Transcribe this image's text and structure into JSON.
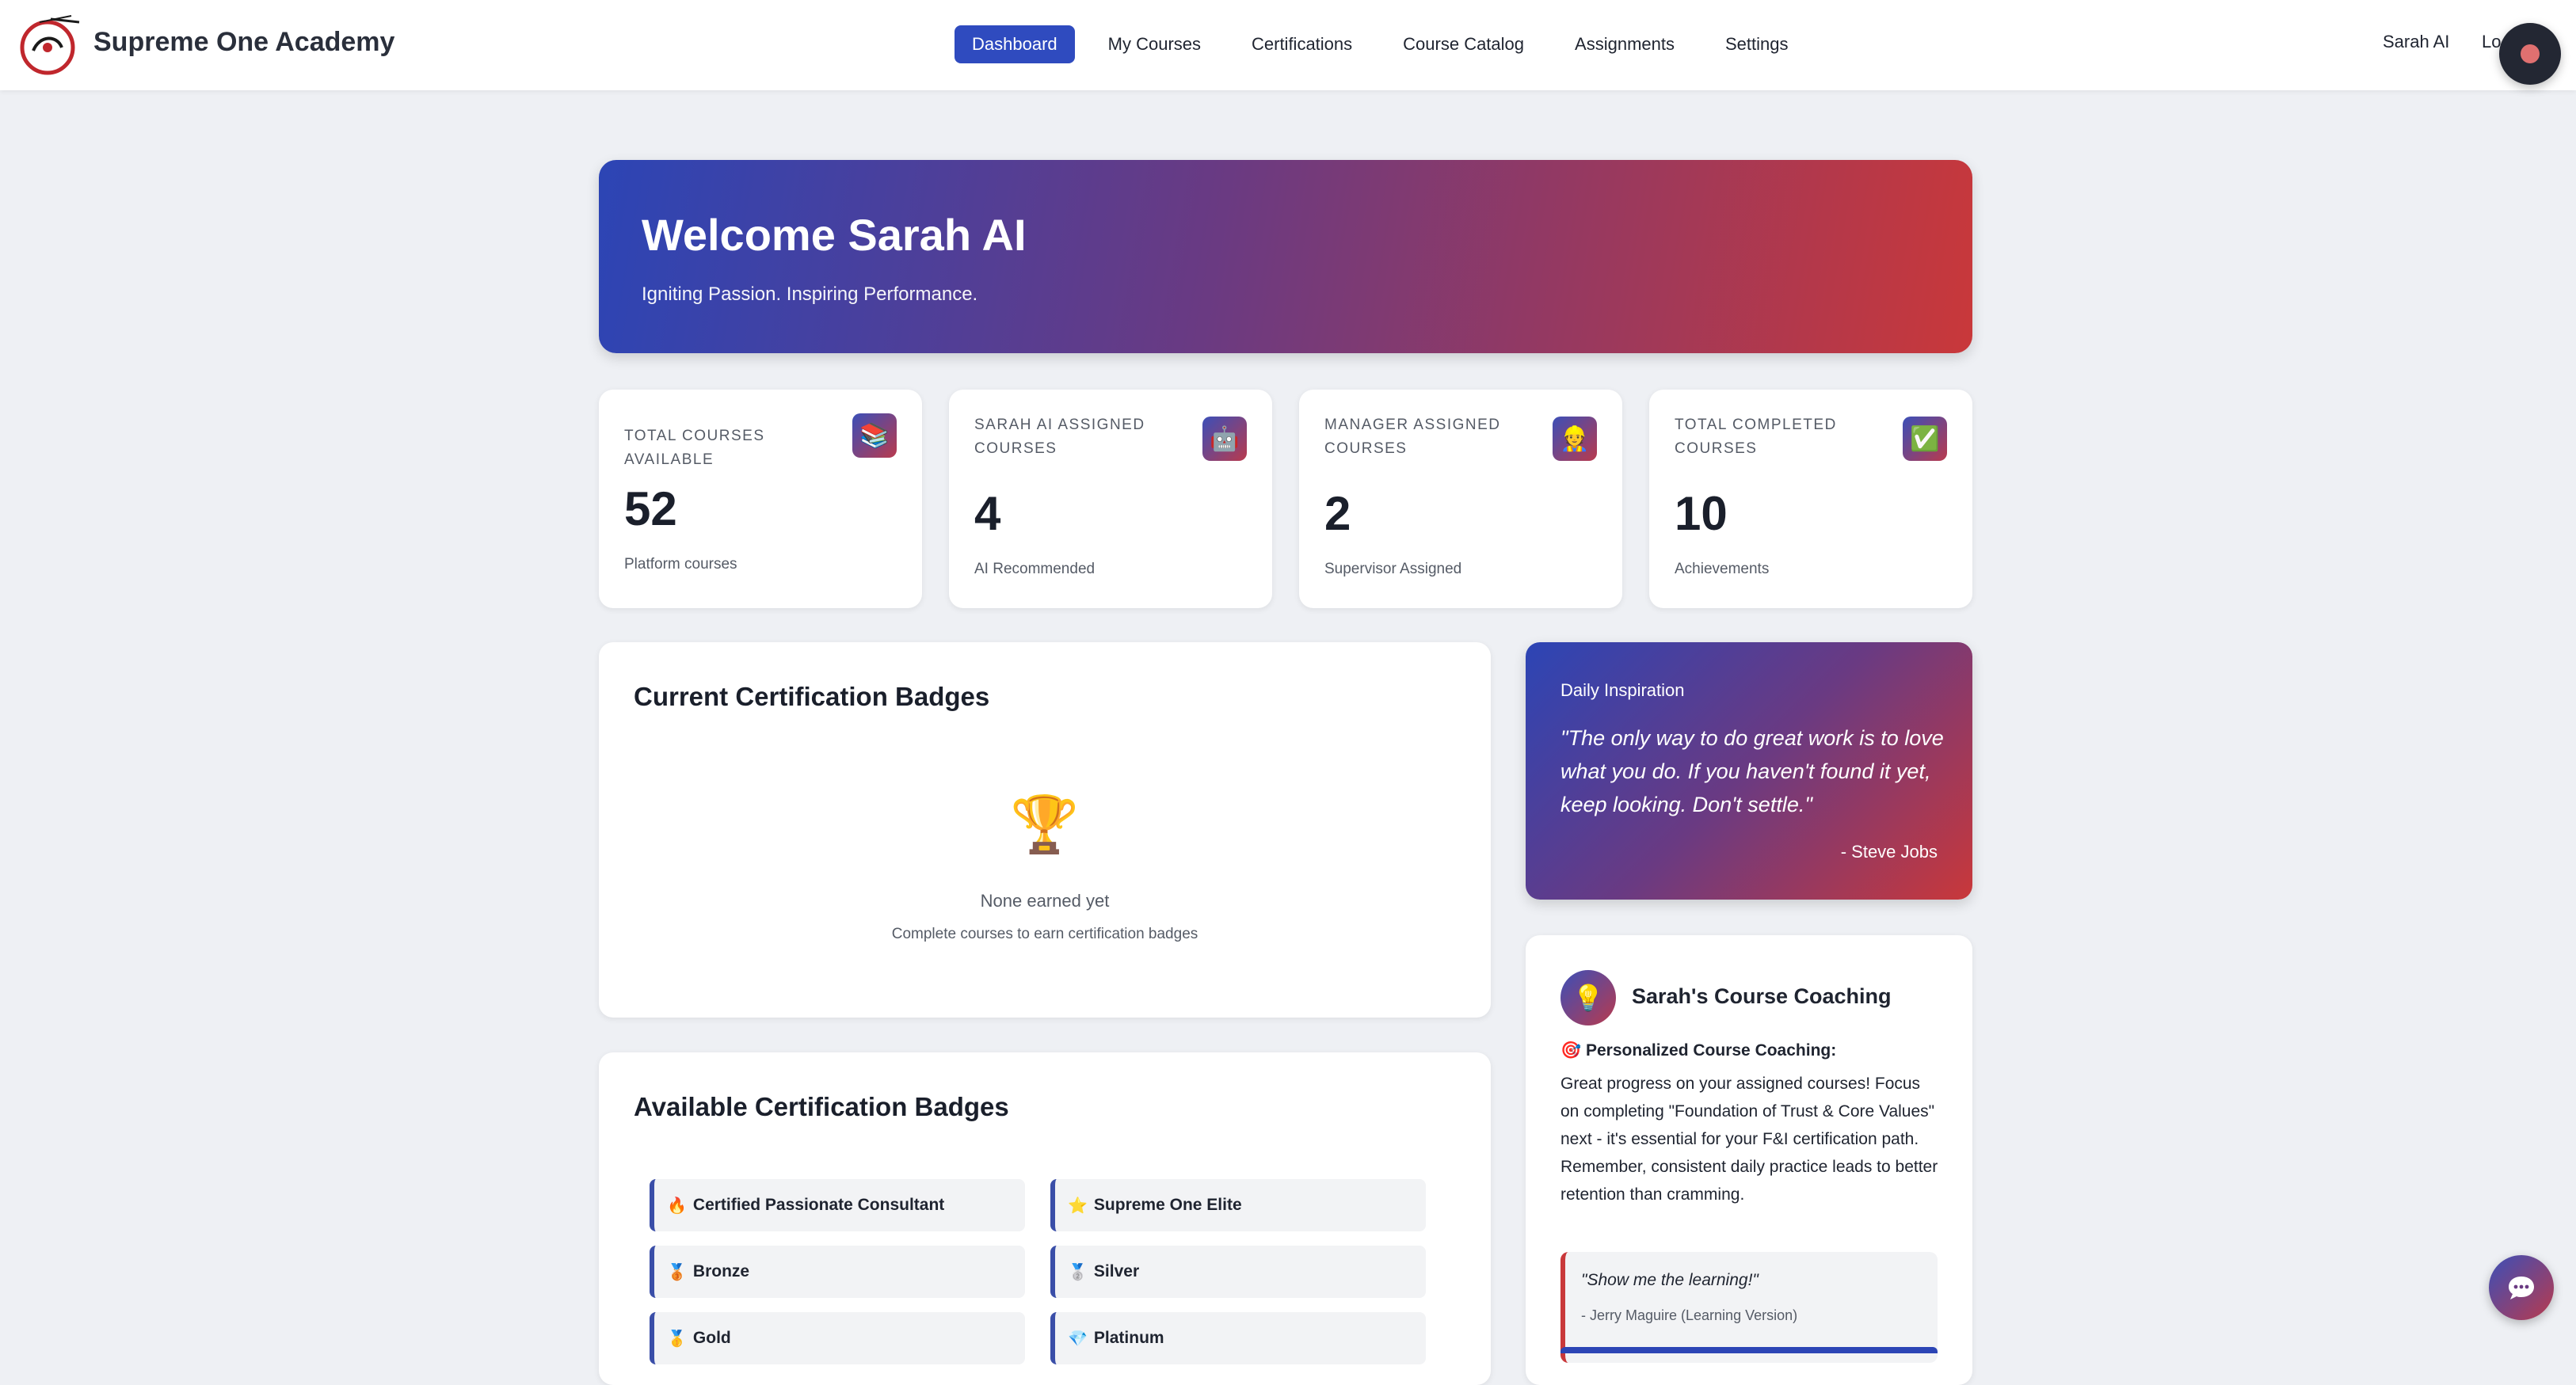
{
  "header": {
    "brand": "Supreme One Academy",
    "nav": [
      {
        "label": "Dashboard",
        "active": true
      },
      {
        "label": "My Courses",
        "active": false
      },
      {
        "label": "Certifications",
        "active": false
      },
      {
        "label": "Course Catalog",
        "active": false
      },
      {
        "label": "Assignments",
        "active": false
      },
      {
        "label": "Settings",
        "active": false
      }
    ],
    "user_name": "Sarah AI",
    "logout_label": "Lo"
  },
  "hero": {
    "title": "Welcome Sarah AI",
    "subtitle": "Igniting Passion. Inspiring Performance."
  },
  "stats": [
    {
      "label": "TOTAL COURSES AVAILABLE",
      "value": "52",
      "note": "Platform courses",
      "icon": "📚"
    },
    {
      "label": "SARAH AI ASSIGNED COURSES",
      "value": "4",
      "note": "AI Recommended",
      "icon": "🤖"
    },
    {
      "label": "MANAGER ASSIGNED COURSES",
      "value": "2",
      "note": "Supervisor Assigned",
      "icon": "👷"
    },
    {
      "label": "TOTAL COMPLETED COURSES",
      "value": "10",
      "note": "Achievements",
      "icon": "✅"
    }
  ],
  "current_badges": {
    "title": "Current Certification Badges",
    "empty_icon": "🏆",
    "empty_title": "None earned yet",
    "empty_subtitle": "Complete courses to earn certification badges"
  },
  "available_badges": {
    "title": "Available Certification Badges",
    "items": [
      {
        "icon": "🔥",
        "label": "Certified Passionate Consultant"
      },
      {
        "icon": "⭐",
        "label": "Supreme One Elite"
      },
      {
        "icon": "🥉",
        "label": "Bronze"
      },
      {
        "icon": "🥈",
        "label": "Silver"
      },
      {
        "icon": "🥇",
        "label": "Gold"
      },
      {
        "icon": "💎",
        "label": "Platinum"
      }
    ]
  },
  "inspiration": {
    "title": "Daily Inspiration",
    "quote": "\"The only way to do great work is to love what you do. If you haven't found it yet, keep looking. Don't settle.\"",
    "author": "- Steve Jobs"
  },
  "coaching": {
    "avatar_icon": "💡",
    "title": "Sarah's Course Coaching",
    "heading_icon": "🎯",
    "heading": "Personalized Course Coaching:",
    "body": "Great progress on your assigned courses! Focus on completing \"Foundation of Trust & Core Values\" next - it's essential for your F&I certification path. Remember, consistent daily practice leads to better retention than cramming.",
    "quote": "\"Show me the learning!\"",
    "quote_author": "- Jerry Maguire (Learning Version)"
  },
  "colors": {
    "accent": "#2f4bbf",
    "gradient_start": "#2c45b5",
    "gradient_end": "#c9383a"
  }
}
